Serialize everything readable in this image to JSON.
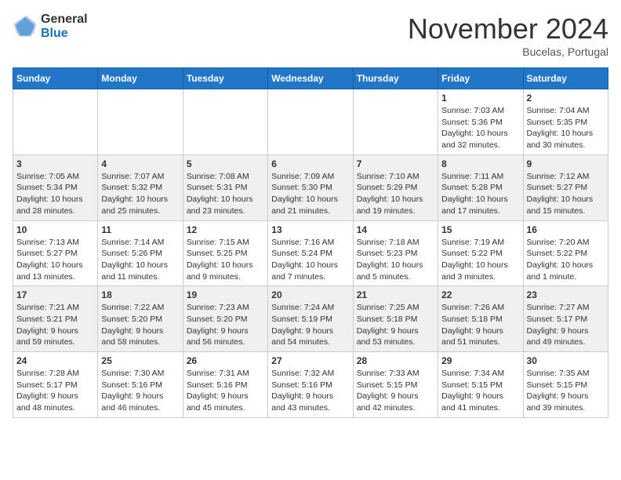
{
  "logo": {
    "general": "General",
    "blue": "Blue"
  },
  "header": {
    "month": "November 2024",
    "location": "Bucelas, Portugal"
  },
  "weekdays": [
    "Sunday",
    "Monday",
    "Tuesday",
    "Wednesday",
    "Thursday",
    "Friday",
    "Saturday"
  ],
  "weeks": [
    [
      {
        "day": "",
        "info": ""
      },
      {
        "day": "",
        "info": ""
      },
      {
        "day": "",
        "info": ""
      },
      {
        "day": "",
        "info": ""
      },
      {
        "day": "",
        "info": ""
      },
      {
        "day": "1",
        "info": "Sunrise: 7:03 AM\nSunset: 5:36 PM\nDaylight: 10 hours\nand 32 minutes."
      },
      {
        "day": "2",
        "info": "Sunrise: 7:04 AM\nSunset: 5:35 PM\nDaylight: 10 hours\nand 30 minutes."
      }
    ],
    [
      {
        "day": "3",
        "info": "Sunrise: 7:05 AM\nSunset: 5:34 PM\nDaylight: 10 hours\nand 28 minutes."
      },
      {
        "day": "4",
        "info": "Sunrise: 7:07 AM\nSunset: 5:32 PM\nDaylight: 10 hours\nand 25 minutes."
      },
      {
        "day": "5",
        "info": "Sunrise: 7:08 AM\nSunset: 5:31 PM\nDaylight: 10 hours\nand 23 minutes."
      },
      {
        "day": "6",
        "info": "Sunrise: 7:09 AM\nSunset: 5:30 PM\nDaylight: 10 hours\nand 21 minutes."
      },
      {
        "day": "7",
        "info": "Sunrise: 7:10 AM\nSunset: 5:29 PM\nDaylight: 10 hours\nand 19 minutes."
      },
      {
        "day": "8",
        "info": "Sunrise: 7:11 AM\nSunset: 5:28 PM\nDaylight: 10 hours\nand 17 minutes."
      },
      {
        "day": "9",
        "info": "Sunrise: 7:12 AM\nSunset: 5:27 PM\nDaylight: 10 hours\nand 15 minutes."
      }
    ],
    [
      {
        "day": "10",
        "info": "Sunrise: 7:13 AM\nSunset: 5:27 PM\nDaylight: 10 hours\nand 13 minutes."
      },
      {
        "day": "11",
        "info": "Sunrise: 7:14 AM\nSunset: 5:26 PM\nDaylight: 10 hours\nand 11 minutes."
      },
      {
        "day": "12",
        "info": "Sunrise: 7:15 AM\nSunset: 5:25 PM\nDaylight: 10 hours\nand 9 minutes."
      },
      {
        "day": "13",
        "info": "Sunrise: 7:16 AM\nSunset: 5:24 PM\nDaylight: 10 hours\nand 7 minutes."
      },
      {
        "day": "14",
        "info": "Sunrise: 7:18 AM\nSunset: 5:23 PM\nDaylight: 10 hours\nand 5 minutes."
      },
      {
        "day": "15",
        "info": "Sunrise: 7:19 AM\nSunset: 5:22 PM\nDaylight: 10 hours\nand 3 minutes."
      },
      {
        "day": "16",
        "info": "Sunrise: 7:20 AM\nSunset: 5:22 PM\nDaylight: 10 hours\nand 1 minute."
      }
    ],
    [
      {
        "day": "17",
        "info": "Sunrise: 7:21 AM\nSunset: 5:21 PM\nDaylight: 9 hours\nand 59 minutes."
      },
      {
        "day": "18",
        "info": "Sunrise: 7:22 AM\nSunset: 5:20 PM\nDaylight: 9 hours\nand 58 minutes."
      },
      {
        "day": "19",
        "info": "Sunrise: 7:23 AM\nSunset: 5:20 PM\nDaylight: 9 hours\nand 56 minutes."
      },
      {
        "day": "20",
        "info": "Sunrise: 7:24 AM\nSunset: 5:19 PM\nDaylight: 9 hours\nand 54 minutes."
      },
      {
        "day": "21",
        "info": "Sunrise: 7:25 AM\nSunset: 5:18 PM\nDaylight: 9 hours\nand 53 minutes."
      },
      {
        "day": "22",
        "info": "Sunrise: 7:26 AM\nSunset: 5:18 PM\nDaylight: 9 hours\nand 51 minutes."
      },
      {
        "day": "23",
        "info": "Sunrise: 7:27 AM\nSunset: 5:17 PM\nDaylight: 9 hours\nand 49 minutes."
      }
    ],
    [
      {
        "day": "24",
        "info": "Sunrise: 7:28 AM\nSunset: 5:17 PM\nDaylight: 9 hours\nand 48 minutes."
      },
      {
        "day": "25",
        "info": "Sunrise: 7:30 AM\nSunset: 5:16 PM\nDaylight: 9 hours\nand 46 minutes."
      },
      {
        "day": "26",
        "info": "Sunrise: 7:31 AM\nSunset: 5:16 PM\nDaylight: 9 hours\nand 45 minutes."
      },
      {
        "day": "27",
        "info": "Sunrise: 7:32 AM\nSunset: 5:16 PM\nDaylight: 9 hours\nand 43 minutes."
      },
      {
        "day": "28",
        "info": "Sunrise: 7:33 AM\nSunset: 5:15 PM\nDaylight: 9 hours\nand 42 minutes."
      },
      {
        "day": "29",
        "info": "Sunrise: 7:34 AM\nSunset: 5:15 PM\nDaylight: 9 hours\nand 41 minutes."
      },
      {
        "day": "30",
        "info": "Sunrise: 7:35 AM\nSunset: 5:15 PM\nDaylight: 9 hours\nand 39 minutes."
      }
    ]
  ]
}
